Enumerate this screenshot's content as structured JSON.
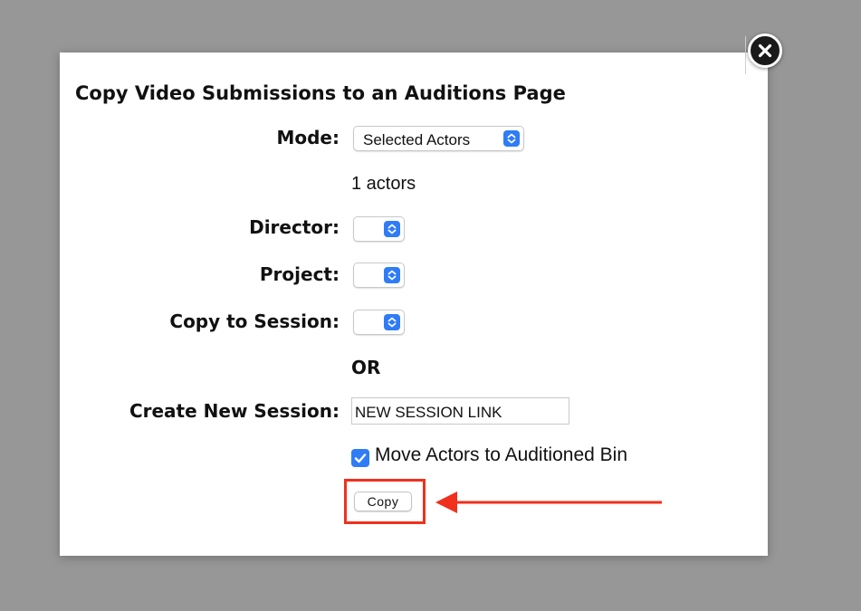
{
  "dialog": {
    "title": "Copy Video Submissions to an Auditions Page",
    "close_icon": "close-x-icon"
  },
  "form": {
    "mode": {
      "label": "Mode:",
      "selected": "Selected Actors"
    },
    "actors_count": "1 actors",
    "director": {
      "label": "Director:",
      "selected": ""
    },
    "project": {
      "label": "Project:",
      "selected": ""
    },
    "copy_to_session": {
      "label": "Copy to Session:",
      "selected": ""
    },
    "or_text": "OR",
    "create_new_session": {
      "label": "Create New Session:",
      "value": "NEW SESSION LINK"
    },
    "move_actors": {
      "label": "Move Actors to Auditioned Bin",
      "checked": true
    },
    "copy_button_label": "Copy"
  },
  "annotation": {
    "color": "#f0301d",
    "icon": "arrow-left-icon"
  },
  "colors": {
    "accent": "#2f7cf6",
    "overlay": "#979797"
  }
}
